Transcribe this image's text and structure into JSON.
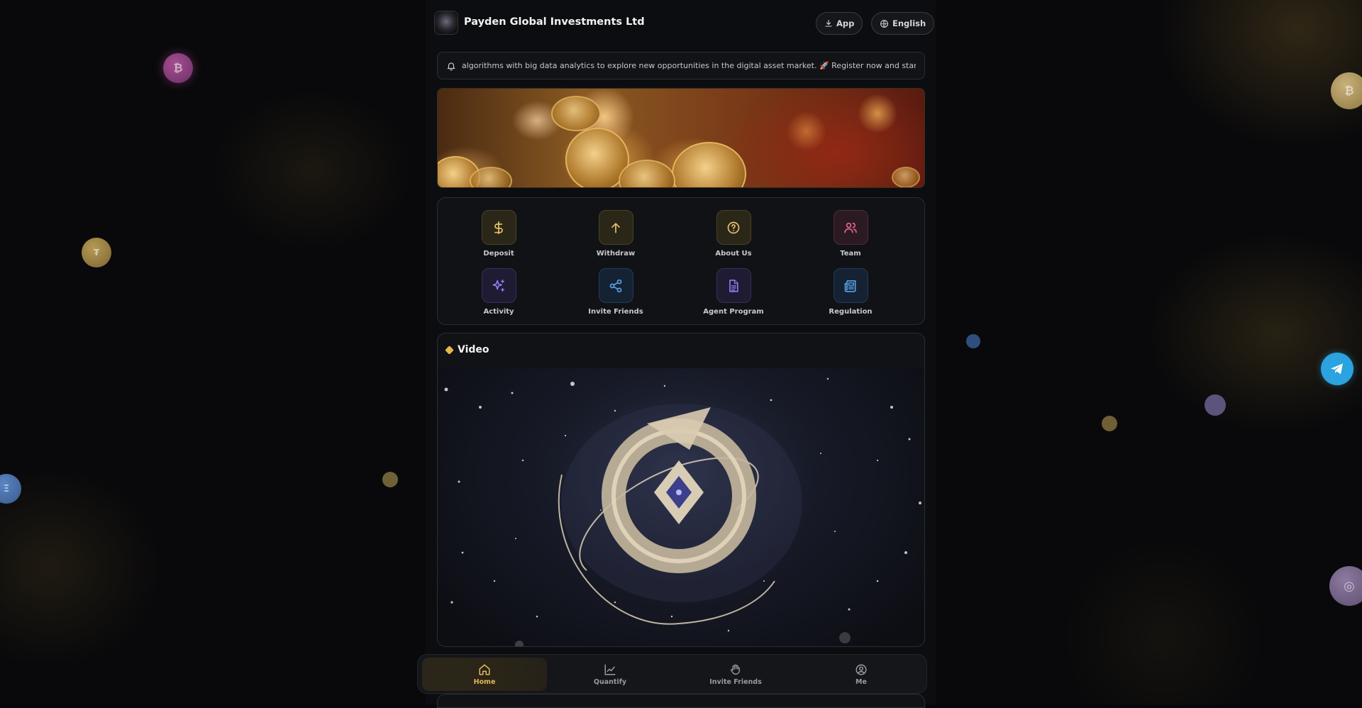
{
  "header": {
    "brand_name": "Payden Global Investments Ltd",
    "app_label": "App",
    "language_label": "English"
  },
  "notice": {
    "text": "algorithms with big data analytics to explore new opportunities in the digital asset market. 🚀 Register now and start your intellig"
  },
  "menu": {
    "items": [
      {
        "label": "Deposit",
        "icon": "dollar-icon",
        "color": "#e8c36a"
      },
      {
        "label": "Withdraw",
        "icon": "arrow-up-icon",
        "color": "#e8c36a"
      },
      {
        "label": "About Us",
        "icon": "question-circle-icon",
        "color": "#e8c36a"
      },
      {
        "label": "Team",
        "icon": "users-icon",
        "color": "#e0668a"
      },
      {
        "label": "Activity",
        "icon": "sparkles-icon",
        "color": "#8f7cf0"
      },
      {
        "label": "Invite Friends",
        "icon": "share-icon",
        "color": "#5aa4e8"
      },
      {
        "label": "Agent Program",
        "icon": "document-icon",
        "color": "#8f7cf0"
      },
      {
        "label": "Regulation",
        "icon": "newspaper-icon",
        "color": "#5aa4e8"
      }
    ]
  },
  "video": {
    "title": "Video"
  },
  "tabbar": {
    "tabs": [
      {
        "label": "Home",
        "icon": "home-icon",
        "active": true
      },
      {
        "label": "Quantify",
        "icon": "chart-icon",
        "active": false
      },
      {
        "label": "Invite Friends",
        "icon": "handshake-icon",
        "active": false
      },
      {
        "label": "Me",
        "icon": "user-circle-icon",
        "active": false
      }
    ]
  },
  "colors": {
    "accent_gold": "#e2b65c",
    "telegram_blue": "#2aa3e0",
    "background": "#09090b"
  }
}
